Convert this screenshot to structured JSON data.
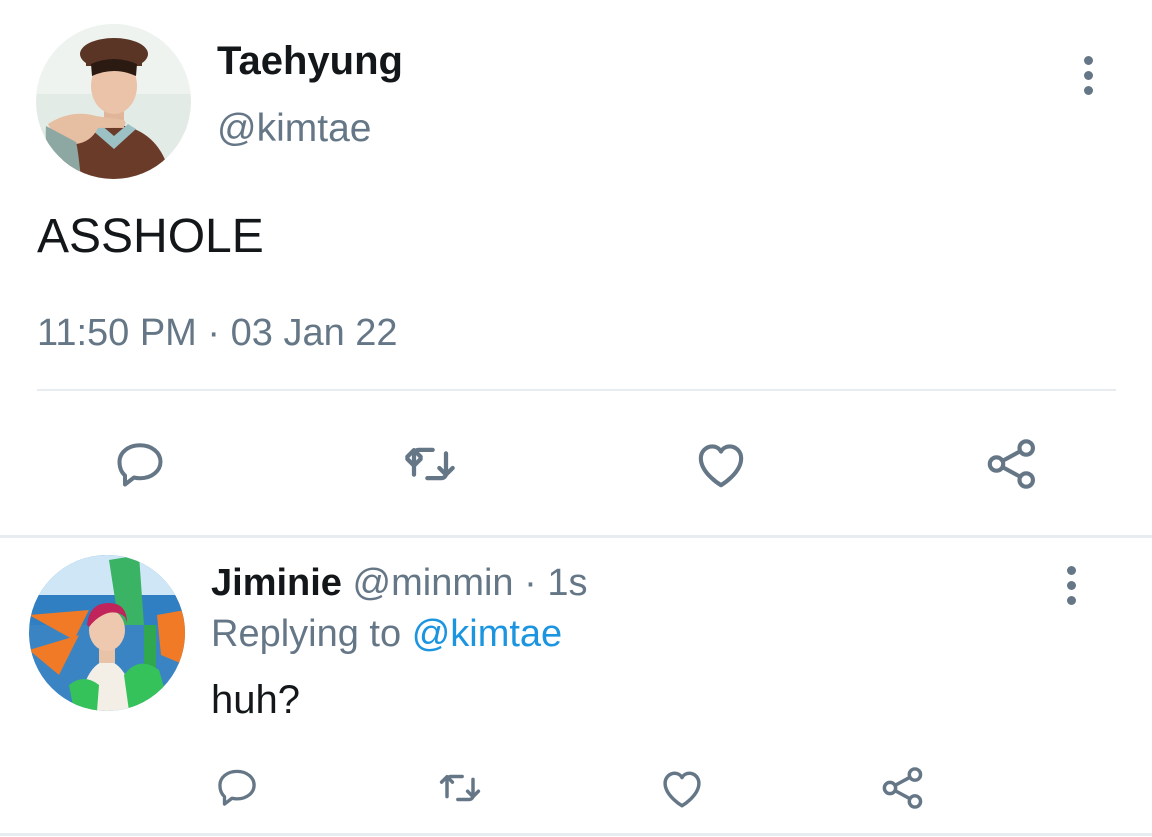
{
  "tweet": {
    "display_name": "Taehyung",
    "handle": "@kimtae",
    "text": "ASSHOLE",
    "time": "11:50 PM",
    "separator": "·",
    "date": "03 Jan 22",
    "avatar_icon": "user-avatar-taehyung",
    "actions": [
      "reply-icon",
      "retweet-icon",
      "like-icon",
      "share-icon"
    ]
  },
  "reply": {
    "display_name": "Jiminie",
    "handle": "@minmin",
    "separator": "·",
    "age": "1s",
    "replying_prefix": "Replying to",
    "replying_handle": "@kimtae",
    "text": "huh?",
    "avatar_icon": "user-avatar-jiminie",
    "actions": [
      "reply-icon",
      "retweet-icon",
      "like-icon",
      "share-icon"
    ]
  },
  "colors": {
    "muted": "#657786",
    "link": "#1b95e0",
    "divider": "#e6ecf0",
    "text": "#14171a"
  }
}
